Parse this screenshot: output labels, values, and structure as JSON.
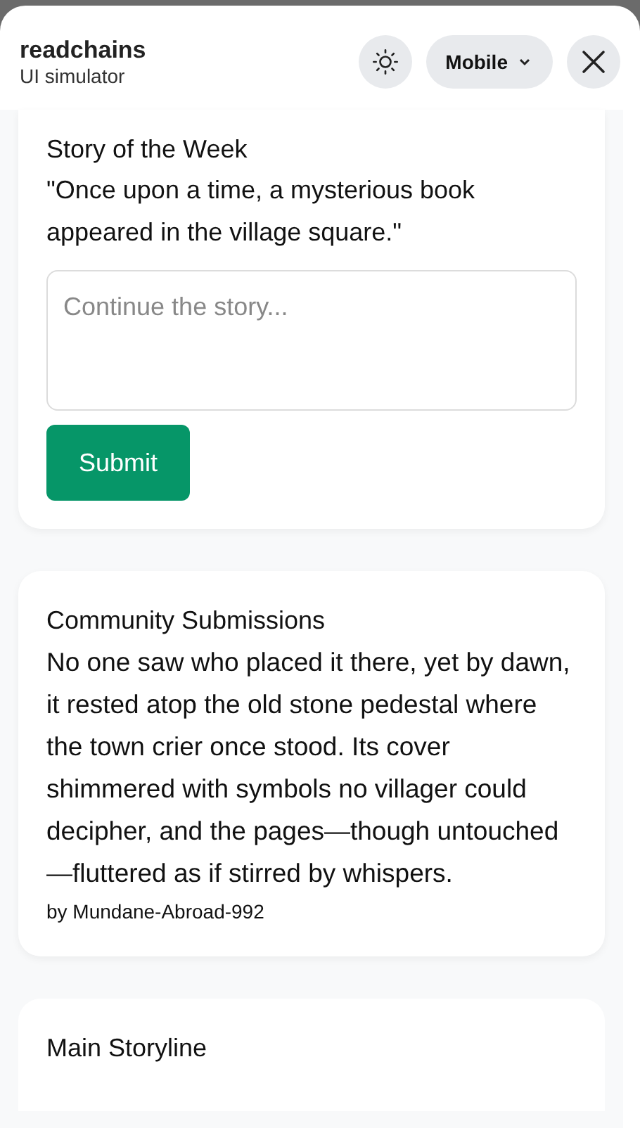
{
  "header": {
    "title": "readchains",
    "subtitle": "UI simulator",
    "device": "Mobile"
  },
  "story_of_the_week": {
    "heading": "Story of the Week",
    "prompt": "\"Once upon a time, a mysterious book appeared in the village square.\"",
    "input": {
      "placeholder": "Continue the story..."
    },
    "submit": "Submit"
  },
  "community_submissions": {
    "heading": "Community Submissions",
    "entries": [
      {
        "text": "No one saw who placed it there, yet by dawn, it rested atop the old stone pedestal where the town crier once stood. Its cover shimmered with symbols no villager could decipher, and the pages—though untouched—fluttered as if stirred by whispers.",
        "author": "by Mundane-Abroad-992"
      }
    ]
  },
  "main_storyline": {
    "heading": "Main Storyline"
  }
}
